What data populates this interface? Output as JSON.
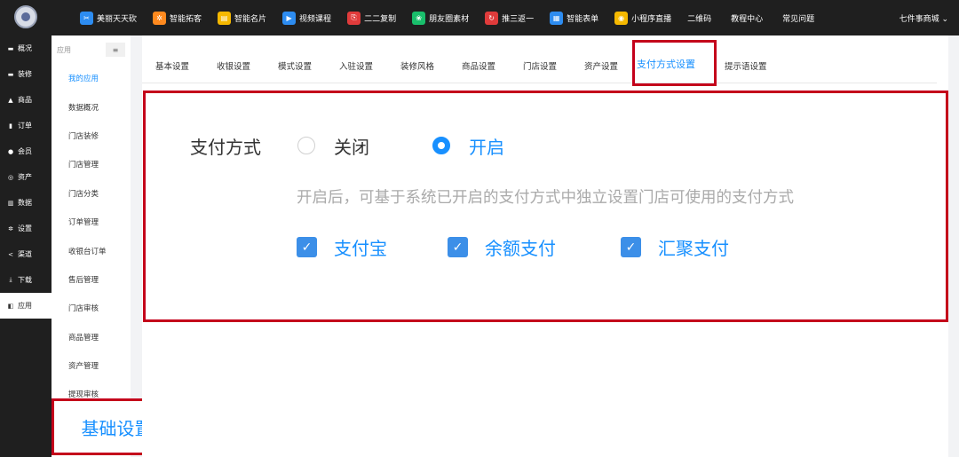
{
  "topnav": {
    "items": [
      {
        "label": "美丽天天砍",
        "color": "#2d8cf0",
        "icon": "scissors-icon",
        "glyph": "✂"
      },
      {
        "label": "智能拓客",
        "color": "#ff8a1f",
        "icon": "network-icon",
        "glyph": "✲"
      },
      {
        "label": "智能名片",
        "color": "#f5b800",
        "icon": "card-icon",
        "glyph": "▤"
      },
      {
        "label": "视频课程",
        "color": "#2d8cf0",
        "icon": "video-icon",
        "glyph": "▶"
      },
      {
        "label": "二二复制",
        "color": "#e03b3b",
        "icon": "copy-icon",
        "glyph": "⎘"
      },
      {
        "label": "朋友圈素材",
        "color": "#19be6b",
        "icon": "moments-icon",
        "glyph": "❀"
      },
      {
        "label": "推三返一",
        "color": "#e03b3b",
        "icon": "refresh-icon",
        "glyph": "↻"
      },
      {
        "label": "智能表单",
        "color": "#2d8cf0",
        "icon": "form-icon",
        "glyph": "▦"
      },
      {
        "label": "小程序直播",
        "color": "#f5b800",
        "icon": "live-icon",
        "glyph": "◉"
      }
    ],
    "plain": [
      "二维码",
      "教程中心",
      "常见问题"
    ],
    "shop": "七件事商城 ⌄"
  },
  "sidebar": [
    {
      "label": "概况",
      "glyph": "▬",
      "icon": "overview-icon"
    },
    {
      "label": "装修",
      "glyph": "▬",
      "icon": "decorate-icon"
    },
    {
      "label": "商品",
      "glyph": "▲",
      "icon": "goods-icon"
    },
    {
      "label": "订单",
      "glyph": "▮",
      "icon": "order-icon"
    },
    {
      "label": "会员",
      "glyph": "●",
      "icon": "member-icon"
    },
    {
      "label": "资产",
      "glyph": "◎",
      "icon": "asset-icon"
    },
    {
      "label": "数据",
      "glyph": "▥",
      "icon": "data-icon"
    },
    {
      "label": "设置",
      "glyph": "✲",
      "icon": "settings-icon"
    },
    {
      "label": "渠道",
      "glyph": "<",
      "icon": "channel-icon"
    },
    {
      "label": "下载",
      "glyph": "⤓",
      "icon": "download-icon"
    },
    {
      "label": "应用",
      "glyph": "◧",
      "icon": "app-icon"
    }
  ],
  "submenu": {
    "title": "应用",
    "toggle": "≡",
    "items": [
      "我的应用",
      "数据概况",
      "门店装修",
      "门店管理",
      "门店分类",
      "订单管理",
      "收银台订单",
      "售后管理",
      "门店审核",
      "商品管理",
      "资产管理",
      "提现审核"
    ],
    "highlight": "基础设置"
  },
  "tabs": [
    "基本设置",
    "收银设置",
    "模式设置",
    "入驻设置",
    "装修风格",
    "商品设置",
    "门店设置",
    "资产设置",
    "支付方式设置",
    "提示语设置"
  ],
  "form": {
    "label": "支付方式",
    "off": "关闭",
    "on": "开启",
    "hint": "开启后，可基于系统已开启的支付方式中独立设置门店可使用的支付方式",
    "methods": [
      "支付宝",
      "余额支付",
      "汇聚支付"
    ],
    "check": "✓"
  },
  "colors": {
    "accent": "#1890ff",
    "highlight": "#c4001b"
  }
}
